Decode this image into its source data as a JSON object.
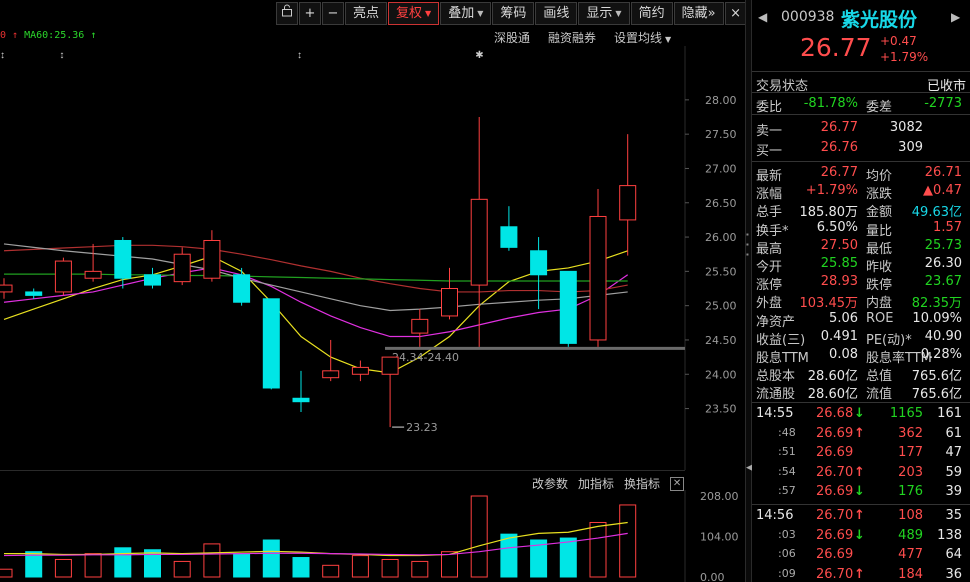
{
  "toolbar": {
    "buttons": [
      {
        "label": "亮点"
      },
      {
        "label": "复权",
        "selected": true,
        "dropdown": true
      },
      {
        "label": "叠加",
        "dropdown": true
      },
      {
        "label": "筹码"
      },
      {
        "label": "画线"
      },
      {
        "label": "显示",
        "dropdown": true
      },
      {
        "label": "简约"
      },
      {
        "label": "隐藏"
      }
    ],
    "lock_icon": "lock-icon",
    "zoom_in": "+",
    "zoom_out": "−",
    "more": "»",
    "close": "×"
  },
  "chart_header": {
    "ma_legend_prefix": "0 ↑",
    "ma_legend": "MA60:25.36 ↑",
    "links": [
      "深股通",
      "融资融券",
      "设置均线"
    ]
  },
  "volume_tools": [
    "改参数",
    "加指标",
    "换指标"
  ],
  "chart_data": [
    {
      "type": "candlestick",
      "y_ticks": [
        "28.00",
        "27.50",
        "27.00",
        "26.50",
        "26.00",
        "25.50",
        "25.00",
        "24.50",
        "24.00",
        "23.50"
      ],
      "ylim": [
        23.1,
        28.1
      ],
      "annotations": {
        "low_marker": "23.23",
        "range_label": "24.34-24.40"
      },
      "candles": [
        {
          "o": 25.2,
          "c": 25.3,
          "h": 25.4,
          "l": 25.1
        },
        {
          "o": 25.2,
          "c": 25.15,
          "h": 25.25,
          "l": 25.1
        },
        {
          "o": 25.2,
          "c": 25.65,
          "h": 25.7,
          "l": 25.15
        },
        {
          "o": 25.4,
          "c": 25.5,
          "h": 25.9,
          "l": 25.35
        },
        {
          "o": 25.95,
          "c": 25.4,
          "h": 26.0,
          "l": 25.25
        },
        {
          "o": 25.45,
          "c": 25.3,
          "h": 25.55,
          "l": 25.25
        },
        {
          "o": 25.35,
          "c": 25.75,
          "h": 25.85,
          "l": 25.3
        },
        {
          "o": 25.4,
          "c": 25.95,
          "h": 26.1,
          "l": 25.35
        },
        {
          "o": 25.45,
          "c": 25.05,
          "h": 25.55,
          "l": 25.0
        },
        {
          "o": 25.1,
          "c": 23.8,
          "h": 25.1,
          "l": 23.78
        },
        {
          "o": 23.65,
          "c": 23.6,
          "h": 24.05,
          "l": 23.45
        },
        {
          "o": 23.95,
          "c": 24.05,
          "h": 24.5,
          "l": 23.9
        },
        {
          "o": 24.0,
          "c": 24.1,
          "h": 24.2,
          "l": 23.9
        },
        {
          "o": 24.0,
          "c": 24.25,
          "h": 24.25,
          "l": 23.23
        },
        {
          "o": 24.6,
          "c": 24.8,
          "h": 24.95,
          "l": 24.4
        },
        {
          "o": 24.85,
          "c": 25.25,
          "h": 25.55,
          "l": 24.8
        },
        {
          "o": 25.3,
          "c": 26.55,
          "h": 27.75,
          "l": 24.4
        },
        {
          "o": 26.15,
          "c": 25.85,
          "h": 26.45,
          "l": 25.8
        },
        {
          "o": 25.8,
          "c": 25.45,
          "h": 26.0,
          "l": 24.95
        },
        {
          "o": 25.5,
          "c": 24.45,
          "h": 25.5,
          "l": 24.4
        },
        {
          "o": 24.5,
          "c": 26.3,
          "h": 26.7,
          "l": 24.4
        },
        {
          "o": 26.25,
          "c": 26.75,
          "h": 27.5,
          "l": 25.73
        }
      ],
      "series": [
        {
          "name": "",
          "color": "#e8e020",
          "values": [
            24.8,
            24.95,
            25.1,
            25.25,
            25.38,
            25.45,
            25.58,
            25.72,
            25.5,
            25.05,
            24.55,
            24.25,
            24.08,
            24.02,
            24.25,
            24.55,
            25.0,
            25.35,
            25.5,
            25.55,
            25.65,
            25.8
          ]
        },
        {
          "name": "",
          "color": "#e030e0",
          "values": [
            25.05,
            25.1,
            25.15,
            25.2,
            25.3,
            25.4,
            25.48,
            25.55,
            25.45,
            25.28,
            25.05,
            24.85,
            24.68,
            24.55,
            24.55,
            24.62,
            24.72,
            24.82,
            24.9,
            24.95,
            25.15,
            25.45
          ]
        },
        {
          "name": "",
          "color": "#b03030",
          "values": [
            25.8,
            25.82,
            25.84,
            25.86,
            25.88,
            25.88,
            25.86,
            25.82,
            25.75,
            25.67,
            25.58,
            25.5,
            25.4,
            25.32,
            25.25,
            25.2,
            25.2,
            25.22,
            25.22,
            25.2,
            25.22,
            25.3
          ]
        },
        {
          "name": "MA60",
          "color": "#20a020",
          "values": [
            25.46,
            25.46,
            25.46,
            25.46,
            25.45,
            25.45,
            25.44,
            25.44,
            25.43,
            25.42,
            25.41,
            25.4,
            25.39,
            25.38,
            25.37,
            25.36,
            25.36,
            25.36,
            25.36,
            25.36,
            25.36,
            25.36
          ]
        },
        {
          "name": "",
          "color": "#a0a0a0",
          "values": [
            25.9,
            25.85,
            25.8,
            25.76,
            25.72,
            25.68,
            25.6,
            25.52,
            25.4,
            25.3,
            25.2,
            25.1,
            25.0,
            24.93,
            24.95,
            24.98,
            25.02,
            25.05,
            25.08,
            25.1,
            25.15,
            25.2
          ]
        }
      ]
    },
    {
      "type": "bar",
      "y_ticks": [
        "208.00",
        "104.00",
        "0.00"
      ],
      "ylim": [
        0,
        208
      ],
      "values": [
        20,
        65,
        45,
        60,
        75,
        70,
        40,
        85,
        60,
        95,
        50,
        30,
        55,
        45,
        40,
        65,
        208,
        110,
        95,
        100,
        140,
        185
      ],
      "series": [
        {
          "name": "",
          "color": "#e8e020",
          "values": [
            60,
            60,
            58,
            58,
            60,
            62,
            60,
            62,
            64,
            66,
            64,
            60,
            58,
            55,
            55,
            58,
            80,
            100,
            112,
            115,
            130,
            140
          ]
        },
        {
          "name": "",
          "color": "#e030e0",
          "values": [
            55,
            56,
            56,
            57,
            57,
            58,
            58,
            59,
            60,
            61,
            61,
            60,
            59,
            58,
            57,
            58,
            65,
            75,
            82,
            90,
            100,
            112
          ]
        }
      ]
    }
  ],
  "quote": {
    "code": "000938",
    "name": "紫光股份",
    "price": "26.77",
    "change": "+0.47",
    "change_pct": "+1.79%",
    "trade_status_label": "交易状态",
    "trade_status": "已收市",
    "webi_label": "委比",
    "webi": "-81.78%",
    "weicha_label": "委差",
    "weicha": "-2773",
    "ask_label": "卖一",
    "ask_price": "26.77",
    "ask_vol": "3082",
    "bid_label": "买一",
    "bid_price": "26.76",
    "bid_vol": "309",
    "stats": [
      {
        "l1": "最新",
        "v1": "26.77",
        "c1": "red",
        "l2": "均价",
        "v2": "26.71",
        "c2": "red"
      },
      {
        "l1": "涨幅",
        "v1": "+1.79%",
        "c1": "red",
        "l2": "涨跌",
        "v2": "▲0.47",
        "c2": "red"
      },
      {
        "l1": "总手",
        "v1": "185.80万",
        "c1": "white",
        "l2": "金额",
        "v2": "49.63亿",
        "c2": "cyan"
      },
      {
        "l1": "换手*",
        "v1": "6.50%",
        "c1": "white",
        "l2": "量比",
        "v2": "1.57",
        "c2": "red"
      },
      {
        "l1": "最高",
        "v1": "27.50",
        "c1": "red",
        "l2": "最低",
        "v2": "25.73",
        "c2": "green"
      },
      {
        "l1": "今开",
        "v1": "25.85",
        "c1": "green",
        "l2": "昨收",
        "v2": "26.30",
        "c2": "white"
      },
      {
        "l1": "涨停",
        "v1": "28.93",
        "c1": "red",
        "l2": "跌停",
        "v2": "23.67",
        "c2": "green"
      },
      {
        "l1": "外盘",
        "v1": "103.45万",
        "c1": "red",
        "l2": "内盘",
        "v2": "82.35万",
        "c2": "green"
      },
      {
        "l1": "净资产",
        "v1": "5.06",
        "c1": "white",
        "l2": "ROE",
        "v2": "10.09%",
        "c2": "white"
      },
      {
        "l1": "收益(三)",
        "v1": "0.491",
        "c1": "white",
        "l2": "PE(动)*",
        "v2": "40.90",
        "c2": "white"
      },
      {
        "l1": "股息TTM",
        "v1": "0.08",
        "c1": "white",
        "l2": "股息率TTM",
        "v2": "0.28%",
        "c2": "white"
      },
      {
        "l1": "总股本",
        "v1": "28.60亿",
        "c1": "white",
        "l2": "总值",
        "v2": "765.6亿",
        "c2": "white"
      },
      {
        "l1": "流通股",
        "v1": "28.60亿",
        "c1": "white",
        "l2": "流值",
        "v2": "765.6亿",
        "c2": "white"
      }
    ],
    "ticks_a": [
      {
        "time": "14:55",
        "price": "26.68",
        "dir": "down",
        "vol": "1165",
        "n": "161"
      },
      {
        "time": ":48",
        "price": "26.69",
        "dir": "up",
        "vol": "362",
        "n": "61"
      },
      {
        "time": ":51",
        "price": "26.69",
        "dir": "",
        "vol": "177",
        "n": "47"
      },
      {
        "time": ":54",
        "price": "26.70",
        "dir": "up",
        "vol": "203",
        "n": "59"
      },
      {
        "time": ":57",
        "price": "26.69",
        "dir": "down",
        "vol": "176",
        "n": "39"
      }
    ],
    "ticks_b": [
      {
        "time": "14:56",
        "price": "26.70",
        "dir": "up",
        "vol": "108",
        "n": "35"
      },
      {
        "time": ":03",
        "price": "26.69",
        "dir": "down",
        "vol": "489",
        "n": "138"
      },
      {
        "time": ":06",
        "price": "26.69",
        "dir": "",
        "vol": "477",
        "n": "64"
      },
      {
        "time": ":09",
        "price": "26.70",
        "dir": "up",
        "vol": "184",
        "n": "36"
      }
    ]
  }
}
